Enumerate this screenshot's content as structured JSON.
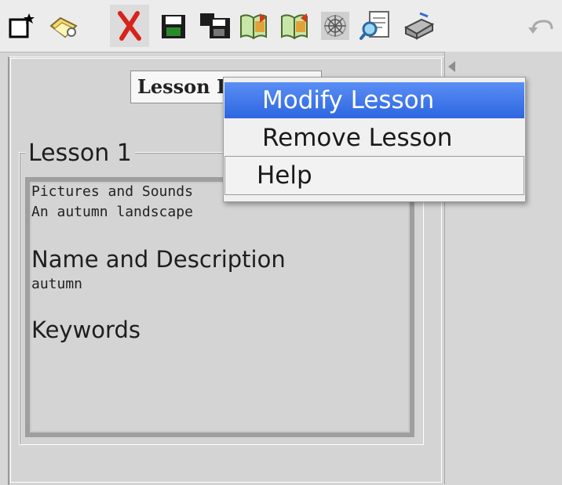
{
  "toolbar": {
    "buttons": [
      {
        "icon": "new-document-icon"
      },
      {
        "icon": "open-folder-icon"
      },
      {
        "icon": "delete-x-icon"
      },
      {
        "icon": "save-disk-icon"
      },
      {
        "icon": "save-as-disk-icon"
      },
      {
        "icon": "import-book-icon"
      },
      {
        "icon": "export-book-icon"
      },
      {
        "icon": "web-icon"
      },
      {
        "icon": "search-document-icon"
      },
      {
        "icon": "printer-icon"
      },
      {
        "icon": "undo-icon"
      }
    ]
  },
  "lesson_list_button": {
    "label": "Lesson List"
  },
  "lesson": {
    "legend": "Lesson 1",
    "line1": "Pictures and Sounds",
    "line2": "An autumn landscape",
    "name_heading": "Name and Description",
    "name_value": "autumn",
    "keywords_heading": "Keywords"
  },
  "context_menu": {
    "items": [
      {
        "label": "Modify Lesson",
        "selected": true
      },
      {
        "label": "Remove Lesson",
        "selected": false
      },
      {
        "label": "Help",
        "selected": false
      }
    ]
  },
  "colors": {
    "selection": "#2d66e0",
    "toolbar_bg": "#ececec",
    "panel_bg": "#d4d4d4"
  }
}
